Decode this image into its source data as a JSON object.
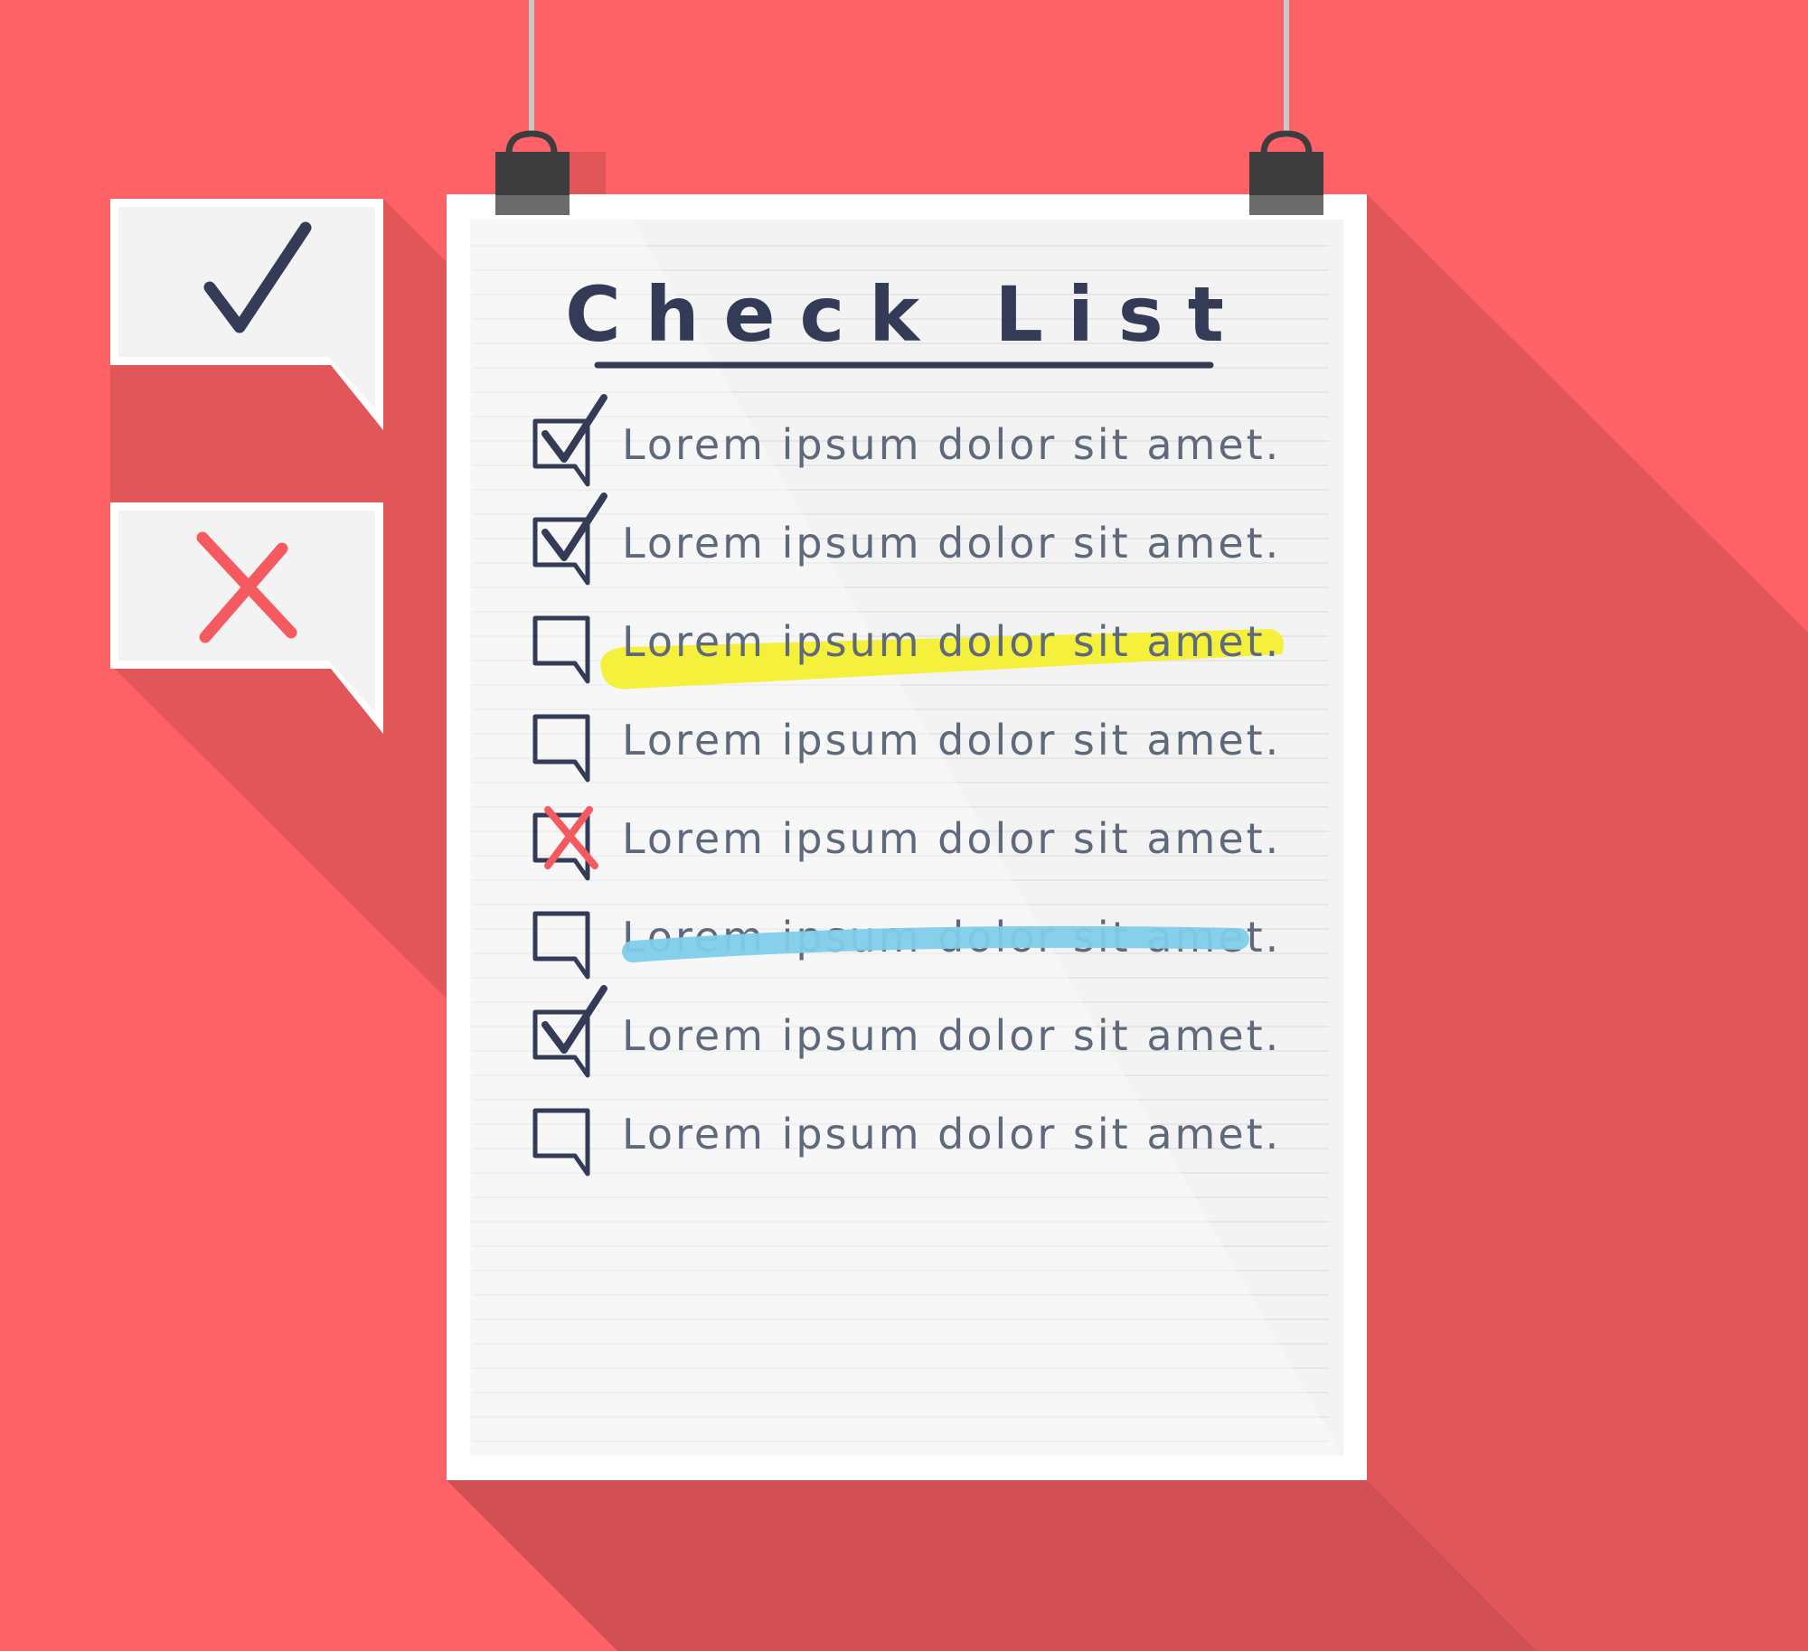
{
  "colors": {
    "background": "#fe6166",
    "shadow": "#d14f53",
    "paper": "#ffffff",
    "paper_inner": "#f3f3f3",
    "ink": "#333b57",
    "item_text": "#5e6a7c",
    "red_mark": "#f55a60",
    "highlight_yellow": "#f5f03c",
    "highlight_blue": "#7fcdea",
    "clip": "#3d3d3d",
    "string": "#c8c8c8"
  },
  "title": "Check List",
  "items": [
    {
      "text": "Lorem ipsum dolor sit amet.",
      "state": "checked",
      "mark": "none"
    },
    {
      "text": "Lorem ipsum dolor sit amet.",
      "state": "checked",
      "mark": "none"
    },
    {
      "text": "Lorem ipsum dolor sit amet.",
      "state": "unchecked",
      "mark": "highlight"
    },
    {
      "text": "Lorem ipsum dolor sit amet.",
      "state": "unchecked",
      "mark": "none"
    },
    {
      "text": "Lorem ipsum dolor sit amet.",
      "state": "crossed",
      "mark": "none"
    },
    {
      "text": "Lorem ipsum dolor sit amet.",
      "state": "unchecked",
      "mark": "strikethrough"
    },
    {
      "text": "Lorem ipsum dolor sit amet.",
      "state": "checked",
      "mark": "none"
    },
    {
      "text": "Lorem ipsum dolor sit amet.",
      "state": "unchecked",
      "mark": "none"
    }
  ],
  "side_bubbles": [
    {
      "icon": "check-mark-icon"
    },
    {
      "icon": "cross-mark-icon"
    }
  ]
}
